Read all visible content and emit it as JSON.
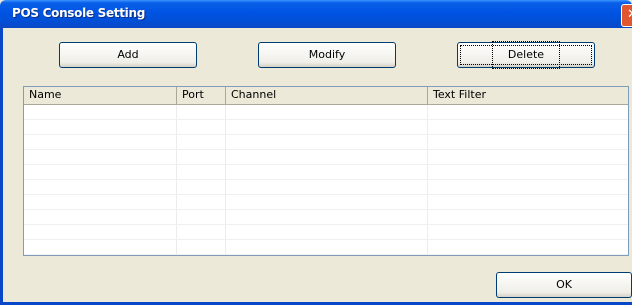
{
  "window": {
    "title": "POS Console Setting",
    "close_glyph": "✕"
  },
  "toolbar": {
    "add_label": "Add",
    "modify_label": "Modify",
    "delete_label": "Delete"
  },
  "table": {
    "columns": [
      "Name",
      "Port",
      "Channel",
      "Text Filter"
    ],
    "rows": []
  },
  "footer": {
    "ok_label": "OK"
  }
}
